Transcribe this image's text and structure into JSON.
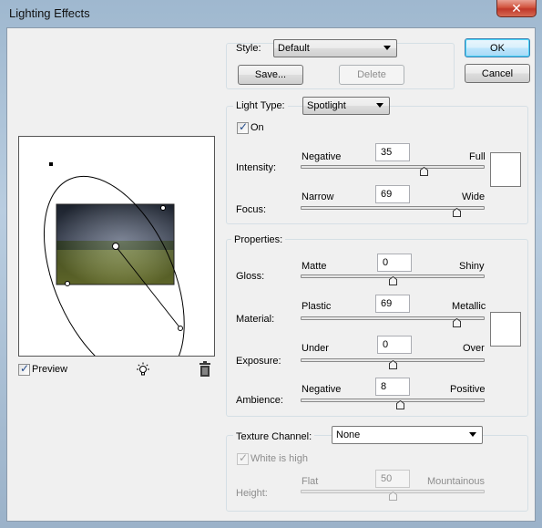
{
  "window": {
    "title": "Lighting Effects",
    "close_glyph": "✕"
  },
  "style": {
    "label": "Style:",
    "value": "Default",
    "save_label": "Save...",
    "delete_label": "Delete"
  },
  "buttons": {
    "ok": "OK",
    "cancel": "Cancel"
  },
  "light_type": {
    "label": "Light Type:",
    "value": "Spotlight",
    "on_label": "On",
    "on_checked": true,
    "intensity": {
      "label": "Intensity:",
      "min_label": "Negative",
      "max_label": "Full",
      "value": "35",
      "fraction": 0.67
    },
    "focus": {
      "label": "Focus:",
      "min_label": "Narrow",
      "max_label": "Wide",
      "value": "69",
      "fraction": 0.85
    }
  },
  "properties": {
    "title": "Properties:",
    "gloss": {
      "label": "Gloss:",
      "min_label": "Matte",
      "max_label": "Shiny",
      "value": "0",
      "fraction": 0.5
    },
    "material": {
      "label": "Material:",
      "min_label": "Plastic",
      "max_label": "Metallic",
      "value": "69",
      "fraction": 0.85
    },
    "exposure": {
      "label": "Exposure:",
      "min_label": "Under",
      "max_label": "Over",
      "value": "0",
      "fraction": 0.5
    },
    "ambience": {
      "label": "Ambience:",
      "min_label": "Negative",
      "max_label": "Positive",
      "value": "8",
      "fraction": 0.54
    }
  },
  "texture": {
    "label": "Texture Channel:",
    "value": "None",
    "white_is_high_label": "White is high",
    "white_is_high_checked": true,
    "height": {
      "label": "Height:",
      "min_label": "Flat",
      "max_label": "Mountainous",
      "value": "50",
      "fraction": 0.5
    }
  },
  "preview": {
    "label": "Preview",
    "checked": true,
    "new_light_icon": "light-bulb-icon",
    "delete_icon": "trash-icon"
  },
  "colors": {
    "swatch_light": "#ffffff",
    "swatch_material": "#ffffff"
  }
}
